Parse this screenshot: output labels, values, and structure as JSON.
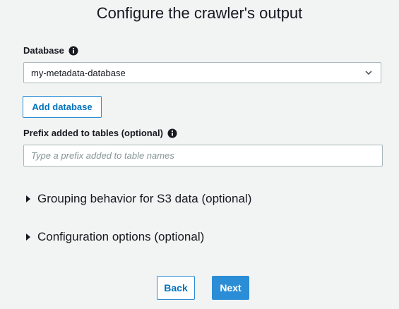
{
  "page": {
    "title": "Configure the crawler's output"
  },
  "database": {
    "label": "Database",
    "info_icon": "info-icon",
    "selected_value": "my-metadata-database",
    "dropdown_icon": "chevron-down-icon",
    "add_button_label": "Add database"
  },
  "prefix": {
    "label": "Prefix added to tables (optional)",
    "info_icon": "info-icon",
    "value": "",
    "placeholder": "Type a prefix added to table names"
  },
  "sections": [
    {
      "label": "Grouping behavior for S3 data (optional)",
      "icon": "caret-right-icon"
    },
    {
      "label": "Configuration options (optional)",
      "icon": "caret-right-icon"
    }
  ],
  "footer": {
    "back_label": "Back",
    "next_label": "Next"
  },
  "colors": {
    "accent": "#0073bb",
    "primary_button": "#2b8dd6",
    "background": "#f2f3f3",
    "border": "#aab7b8"
  }
}
